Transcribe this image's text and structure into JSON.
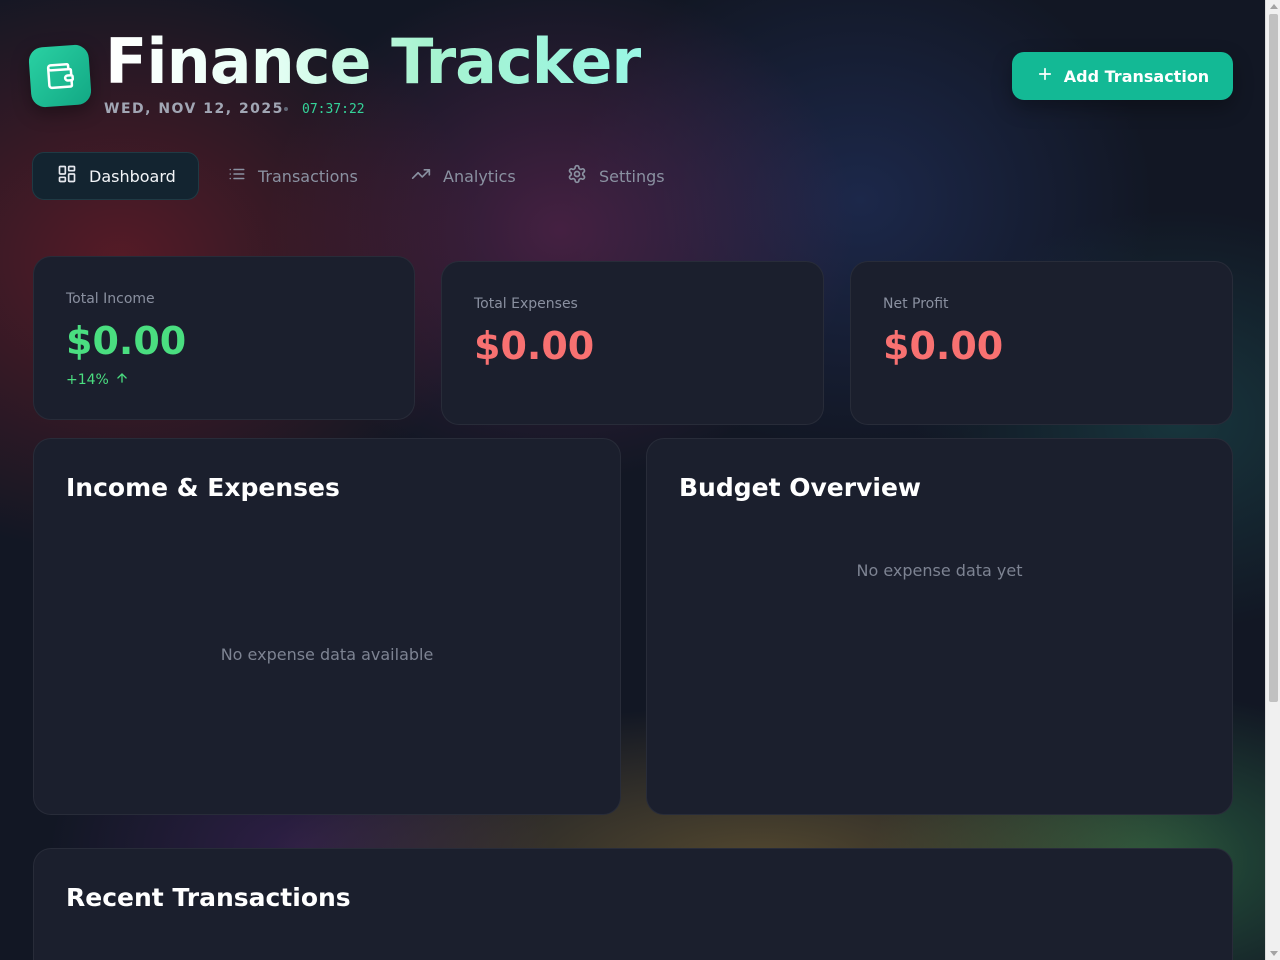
{
  "header": {
    "title": "Finance Tracker",
    "date": "WED, NOV 12, 2025",
    "time": "07:37:22",
    "add_button_label": "Add Transaction",
    "logo_icon": "wallet-icon"
  },
  "nav": {
    "items": [
      {
        "label": "Dashboard",
        "icon": "grid-icon",
        "active": true
      },
      {
        "label": "Transactions",
        "icon": "list-icon",
        "active": false
      },
      {
        "label": "Analytics",
        "icon": "trending-up-icon",
        "active": false
      },
      {
        "label": "Settings",
        "icon": "gear-icon",
        "active": false
      }
    ]
  },
  "stats": {
    "income": {
      "label": "Total Income",
      "value": "$0.00",
      "trend": "+14%"
    },
    "expenses": {
      "label": "Total Expenses",
      "value": "$0.00"
    },
    "profit": {
      "label": "Net Profit",
      "value": "$0.00"
    }
  },
  "income_expenses": {
    "title": "Income & Expenses",
    "empty_text": "No expense data available"
  },
  "budget": {
    "title": "Budget Overview",
    "empty_text": "No expense data yet"
  },
  "recent": {
    "title": "Recent Transactions"
  },
  "colors": {
    "accent": "#13b995",
    "income": "#4ade80",
    "expense": "#f87171",
    "card_bg": "#1b1f2d"
  }
}
